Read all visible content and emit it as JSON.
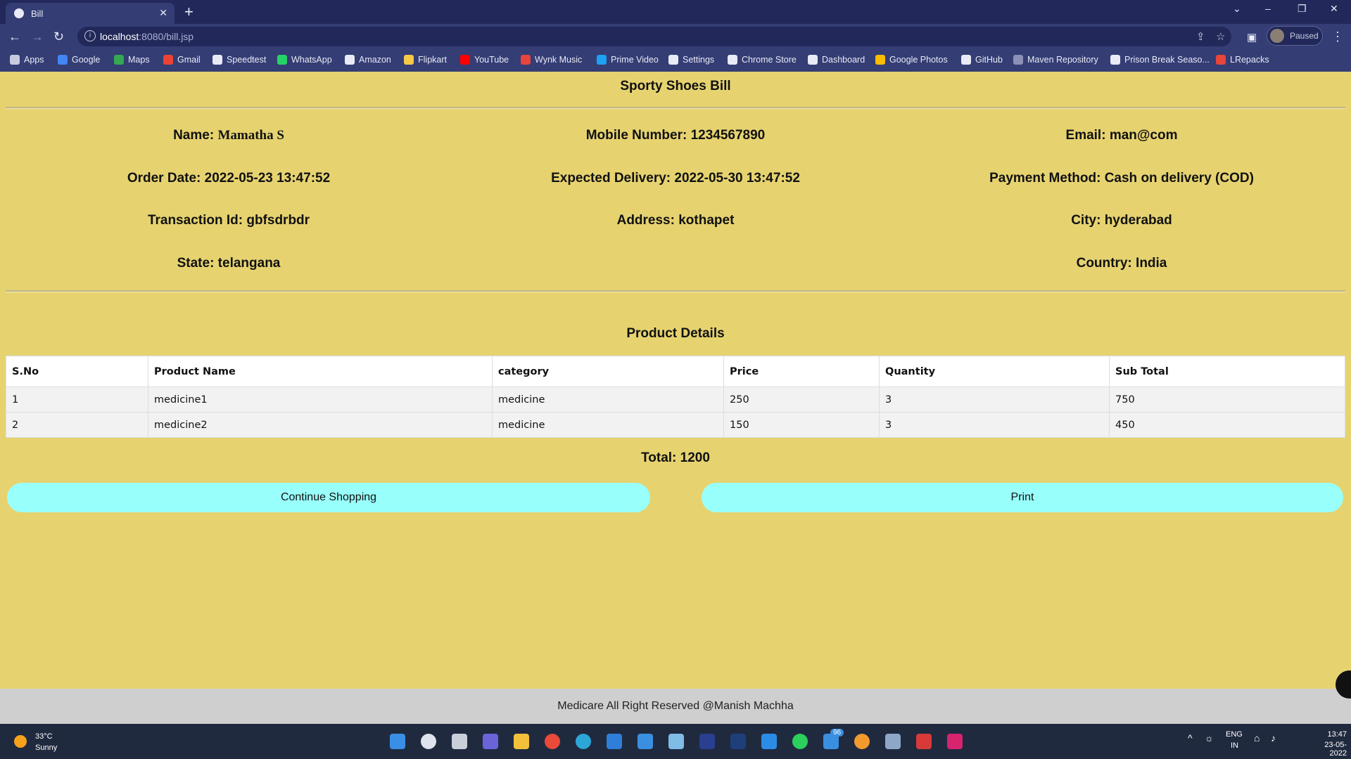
{
  "browser": {
    "tab_title": "Bill",
    "url_host": "localhost",
    "url_path": ":8080/bill.jsp",
    "profile_label": "Paused",
    "bookmarks": [
      "Apps",
      "Google",
      "Maps",
      "Gmail",
      "Speedtest",
      "WhatsApp",
      "Amazon",
      "Flipkart",
      "YouTube",
      "Wynk Music",
      "Prime Video",
      "Settings",
      "Chrome Store",
      "Dashboard",
      "Google Photos",
      "GitHub",
      "Maven Repository",
      "Prison Break Seaso...",
      "LRepacks"
    ]
  },
  "page": {
    "title": "Sporty Shoes Bill",
    "customer": {
      "name_label": "Name: ",
      "name_value": "Mamatha S",
      "mobile": "Mobile Number: 1234567890",
      "email": "Email: man@com",
      "order_date": "Order Date: 2022-05-23 13:47:52",
      "expected_delivery": "Expected Delivery: 2022-05-30 13:47:52",
      "payment_method": "Payment Method: Cash on delivery (COD)",
      "transaction_id": "Transaction Id: gbfsdrbdr",
      "address": "Address: kothapet",
      "city": "City: hyderabad",
      "state": "State: telangana",
      "country": "Country: India"
    },
    "product_heading": "Product Details",
    "table": {
      "headers": [
        "S.No",
        "Product Name",
        "category",
        "Price",
        "Quantity",
        "Sub Total"
      ],
      "rows": [
        [
          "1",
          "medicine1",
          "medicine",
          "250",
          "3",
          "750"
        ],
        [
          "2",
          "medicine2",
          "medicine",
          "150",
          "3",
          "450"
        ]
      ]
    },
    "total": "Total: 1200",
    "continue_button": "Continue Shopping",
    "print_button": "Print",
    "footer": "Medicare All Right Reserved @Manish Machha"
  },
  "taskbar": {
    "temperature": "33°C",
    "weather": "Sunny",
    "lang": "ENG",
    "region": "IN",
    "time": "13:47",
    "date": "23-05-2022",
    "badge": "96"
  }
}
